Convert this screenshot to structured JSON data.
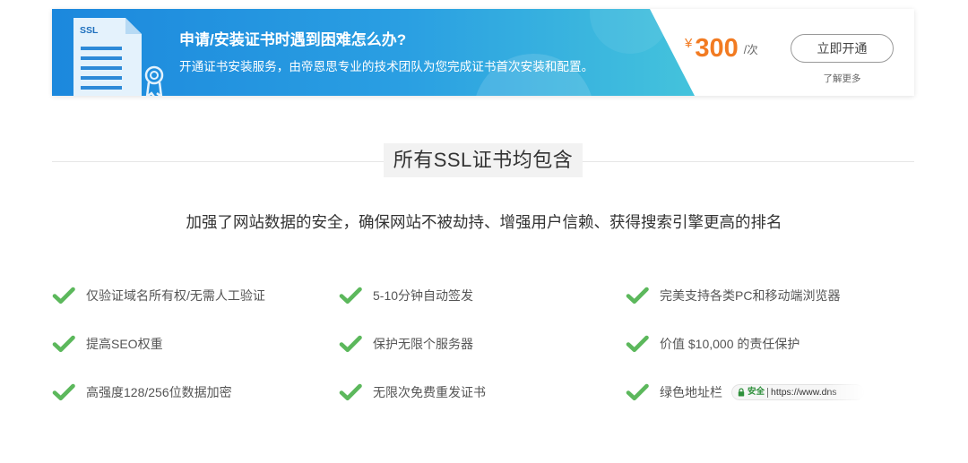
{
  "banner": {
    "icon": "ssl-certificate-document-icon",
    "icon_label": "SSL",
    "title": "申请/安装证书时遇到困难怎么办?",
    "subtitle": "开通证书安装服务，由帝恩思专业的技术团队为您完成证书首次安装和配置。",
    "price": {
      "currency": "¥",
      "amount": "300",
      "unit": "/次"
    },
    "cta_label": "立即开通",
    "learn_more_label": "了解更多"
  },
  "section": {
    "title": "所有SSL证书均包含",
    "description": "加强了网站数据的安全，确保网站不被劫持、增强用户信赖、获得搜索引擎更高的排名"
  },
  "features": [
    {
      "icon": "check-icon",
      "text": "仅验证域名所有权/无需人工验证"
    },
    {
      "icon": "check-icon",
      "text": "5-10分钟自动签发"
    },
    {
      "icon": "check-icon",
      "text": "完美支持各类PC和移动端浏览器"
    },
    {
      "icon": "check-icon",
      "text": "提高SEO权重"
    },
    {
      "icon": "check-icon",
      "text": "保护无限个服务器"
    },
    {
      "icon": "check-icon",
      "text": "价值 $10,000 的责任保护"
    },
    {
      "icon": "check-icon",
      "text": "高强度128/256位数据加密"
    },
    {
      "icon": "check-icon",
      "text": "无限次免费重发证书"
    },
    {
      "icon": "check-icon",
      "text": "绿色地址栏",
      "badge": {
        "icon": "lock-icon",
        "label": "安全",
        "url": "https://www.dns"
      }
    }
  ],
  "colors": {
    "banner_gradient_start": "#1c88dd",
    "banner_gradient_end": "#44c3dc",
    "price": "#f27b22",
    "check": "#5cb85c",
    "secure": "#2d8f3a"
  }
}
